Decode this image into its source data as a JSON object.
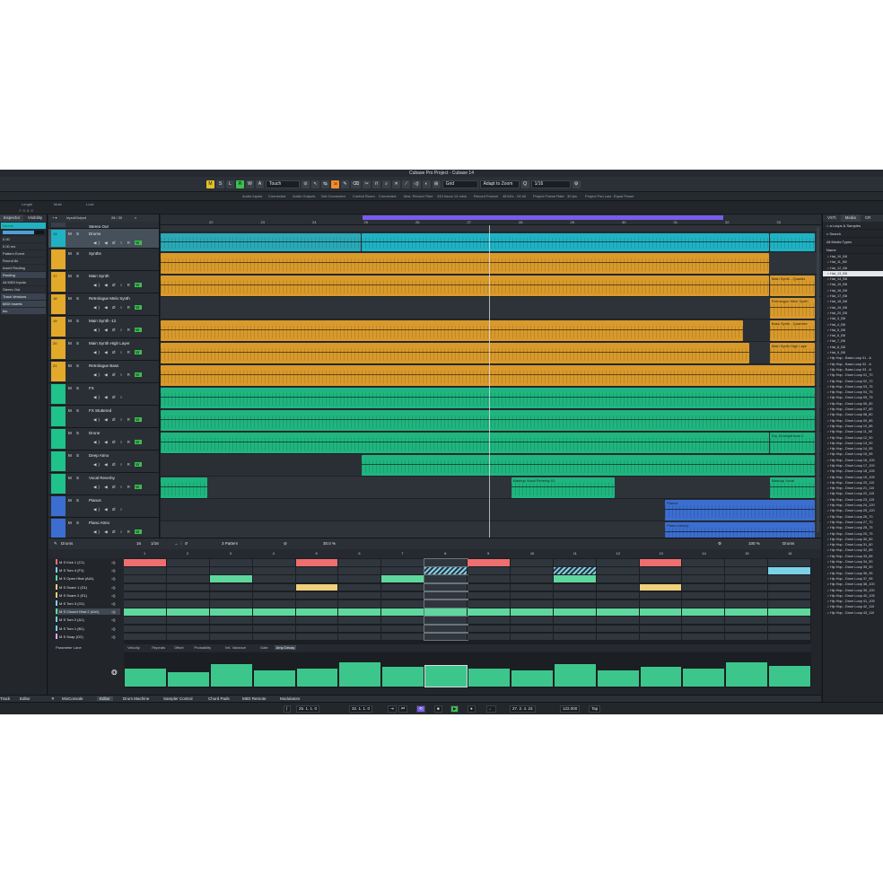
{
  "window_title": "Cubase Pro Project - Cubase 14",
  "colors": {
    "cyan": "#1fb2c3",
    "orange": "#d99a2b",
    "green": "#1fb57f",
    "blue": "#3b6ed0",
    "purple": "#7a5ce8",
    "record_green": "#3cbf4f"
  },
  "toolbar": {
    "state_buttons": [
      "M",
      "S",
      "L",
      "R",
      "W",
      "A"
    ],
    "automation_mode": "Touch",
    "snap_type": "Grid",
    "snap_mode": "Adapt to Zoom",
    "quantize": "1/16"
  },
  "info_bar": [
    {
      "label": "Audio Inputs",
      "value": "Connected"
    },
    {
      "label": "Audio Outputs",
      "value": "Not Connected"
    },
    {
      "label": "Control Room",
      "value": "Connected"
    },
    {
      "label": "Max. Record Time",
      "value": "243 hours 14 mins"
    },
    {
      "label": "Record Format",
      "value": "48 kHz - 24 bit"
    },
    {
      "label": "Project Frame Rate",
      "value": "30 fps"
    },
    {
      "label": "Project Pan Law",
      "value": "Equal Power"
    }
  ],
  "status_line": {
    "length_label": "Length",
    "length_value": "7. 0. 0. 0",
    "mute_label": "Mute",
    "lock_label": "Lock"
  },
  "inspector": {
    "tabs": [
      "Inspector",
      "Visibility"
    ],
    "rows": [
      "Pattern Event",
      "Round 8s",
      "Insert Routing",
      "All MIDI Inputs",
      "Stereo Out"
    ],
    "sections": [
      "Routing",
      "Track Versions",
      "MIDI Inserts",
      "Inc"
    ],
    "volume_label": "0.00",
    "pan_label": "0.00 ms",
    "volume_level": 0.75
  },
  "tracklist": {
    "header": "Input/Output",
    "counter": "28 / 30"
  },
  "tracks": [
    {
      "num": "",
      "name": "Stereo Out",
      "ctl": "",
      "color": "#3a4048",
      "h": 8
    },
    {
      "num": "13",
      "name": "Drums",
      "ctl": "◀) ◀ Ø ○ R W",
      "color": "#1fb2c3",
      "h": 22,
      "sel": true
    },
    {
      "num": "",
      "name": "Synths",
      "ctl": "",
      "color": "#e2a92a",
      "h": 25
    },
    {
      "num": "17",
      "name": "Main Synth",
      "ctl": "◀) ◀ Ø ○ R W",
      "color": "#e2a92a",
      "h": 25
    },
    {
      "num": "18",
      "name": "Retrologue Melo Synth",
      "ctl": "◀) ◀ Ø ○ R W",
      "color": "#e2a92a",
      "h": 25
    },
    {
      "num": "19",
      "name": "Main Synth -12",
      "ctl": "◀) ◀ Ø ○ R W",
      "color": "#e2a92a",
      "h": 25
    },
    {
      "num": "20",
      "name": "Main Synth High Layer",
      "ctl": "◀) ◀ Ø ○ R W",
      "color": "#e2a92a",
      "h": 25
    },
    {
      "num": "21",
      "name": "Retrologue Bass",
      "ctl": "◀) ◀ Ø ○ R W",
      "color": "#e2a92a",
      "h": 25
    },
    {
      "num": "",
      "name": "FX",
      "ctl": "◀) ◀ Ø ○",
      "color": "#1fc28a",
      "h": 25
    },
    {
      "num": "",
      "name": "FX Stuttered",
      "ctl": "◀) ◀ Ø ○ R W",
      "color": "#1fc28a",
      "h": 25
    },
    {
      "num": "",
      "name": "Drone",
      "ctl": "◀) ◀ Ø ○ R W",
      "color": "#1fc28a",
      "h": 25
    },
    {
      "num": "",
      "name": "Deep Atmo",
      "ctl": "◀) ◀ Ø ○ R W",
      "color": "#1fc28a",
      "h": 25
    },
    {
      "num": "",
      "name": "Vocal Reverby",
      "ctl": "◀) ◀ Ø ○ R W",
      "color": "#1fc28a",
      "h": 25
    },
    {
      "num": "",
      "name": "Pianos",
      "ctl": "◀) ◀ Ø ○",
      "color": "#3b6ed0",
      "h": 25
    },
    {
      "num": "",
      "name": "Piano Atmo",
      "ctl": "◀) ◀ Ø ○ R W",
      "color": "#3b6ed0",
      "h": 25
    }
  ],
  "ruler": {
    "labels": [
      "22",
      "23",
      "24",
      "25",
      "26",
      "27",
      "28",
      "29",
      "30",
      "31",
      "32",
      "33"
    ]
  },
  "events": [
    {
      "lane": 1,
      "x0": 0.0,
      "x1": 0.307,
      "color": "#2aa9b6",
      "label": ""
    },
    {
      "lane": 1,
      "x0": 0.307,
      "x1": 0.93,
      "color": "#1fb2c3",
      "label": ""
    },
    {
      "lane": 1,
      "x0": 0.93,
      "x1": 1.0,
      "color": "#1fb2c3",
      "label": ""
    },
    {
      "lane": 2,
      "x0": 0.0,
      "x1": 0.93,
      "color": "#d99a2b",
      "label": ""
    },
    {
      "lane": 3,
      "x0": 0.0,
      "x1": 0.93,
      "color": "#d99a2b",
      "label": ""
    },
    {
      "lane": 3,
      "x0": 0.93,
      "x1": 1.0,
      "color": "#d99a2b",
      "label": "Main Synth - Quantiz"
    },
    {
      "lane": 4,
      "x0": 0.93,
      "x1": 1.0,
      "color": "#d99a2b",
      "label": "Retrologue Melo Synth"
    },
    {
      "lane": 5,
      "x0": 0.0,
      "x1": 0.89,
      "color": "#d99a2b",
      "label": ""
    },
    {
      "lane": 5,
      "x0": 0.93,
      "x1": 1.0,
      "color": "#d99a2b",
      "label": "Bass Synth - Quantize"
    },
    {
      "lane": 6,
      "x0": 0.0,
      "x1": 0.9,
      "color": "#d99a2b",
      "label": ""
    },
    {
      "lane": 6,
      "x0": 0.93,
      "x1": 1.0,
      "color": "#d99a2b",
      "label": "Main Synth High Laye"
    },
    {
      "lane": 7,
      "x0": 0.0,
      "x1": 1.0,
      "color": "#d99a2b",
      "label": ""
    },
    {
      "lane": 8,
      "x0": 0.0,
      "x1": 1.0,
      "color": "#1fb57f",
      "label": ""
    },
    {
      "lane": 9,
      "x0": 0.0,
      "x1": 1.0,
      "color": "#1fb57f",
      "label": ""
    },
    {
      "lane": 10,
      "x0": 0.0,
      "x1": 0.93,
      "color": "#1fb57f",
      "label": ""
    },
    {
      "lane": 10,
      "x0": 0.93,
      "x1": 1.0,
      "color": "#1fb57f",
      "label": "Dry 16-bright tone 2"
    },
    {
      "lane": 11,
      "x0": 0.307,
      "x1": 1.0,
      "color": "#1fb57f",
      "label": ""
    },
    {
      "lane": 12,
      "x0": 0.0,
      "x1": 0.073,
      "color": "#1fb57f",
      "label": ""
    },
    {
      "lane": 12,
      "x0": 0.535,
      "x1": 0.695,
      "color": "#1fb57f",
      "label": "Mashup Vocal Reverby 01"
    },
    {
      "lane": 12,
      "x0": 0.93,
      "x1": 1.0,
      "color": "#1fb57f",
      "label": "Mashup Vocal"
    },
    {
      "lane": 13,
      "x0": 0.77,
      "x1": 1.0,
      "color": "#3b6ed0",
      "label": "Pianos"
    },
    {
      "lane": 14,
      "x0": 0.77,
      "x1": 1.0,
      "color": "#3b6ed0",
      "label": "Piano melody"
    }
  ],
  "editor": {
    "track_name": "Drums",
    "pattern_length": "16",
    "resolution": "1/16",
    "pattern_name": "3 Pattern",
    "swing_value": "30.0 %",
    "zoom_value": "100 %",
    "kit_name": "Drums",
    "step_numbers": [
      "1",
      "2",
      "3",
      "4",
      "5",
      "6",
      "7",
      "8",
      "9",
      "10",
      "11",
      "12",
      "13",
      "14",
      "15",
      "16"
    ],
    "pads": [
      {
        "name": "Kick 1 (C1)",
        "color": "#f06e6e",
        "steps": [
          1,
          0,
          0,
          0,
          1,
          0,
          0,
          0,
          1,
          0,
          0,
          0,
          1,
          0,
          0,
          0
        ]
      },
      {
        "name": "Tom 4 (F1)",
        "color": "#7ad2e8",
        "steps": [
          0,
          0,
          0,
          0,
          0,
          0,
          0,
          2,
          0,
          0,
          2,
          0,
          0,
          0,
          0,
          1
        ]
      },
      {
        "name": "Open Hhat (A#1)",
        "color": "#5fd89e",
        "steps": [
          0,
          0,
          1,
          0,
          0,
          0,
          1,
          0,
          0,
          0,
          1,
          0,
          0,
          0,
          0,
          0
        ]
      },
      {
        "name": "Snare 1 (D1)",
        "color": "#f0d07a",
        "steps": [
          0,
          0,
          0,
          0,
          1,
          0,
          0,
          0,
          0,
          0,
          0,
          0,
          1,
          0,
          0,
          0
        ]
      },
      {
        "name": "Snare 2 (E1)",
        "color": "#f0d07a",
        "steps": [
          0,
          0,
          0,
          0,
          0,
          0,
          0,
          0,
          0,
          0,
          0,
          0,
          0,
          0,
          0,
          0
        ]
      },
      {
        "name": "Tom 3 (G1)",
        "color": "#7ad2e8",
        "steps": [
          0,
          0,
          0,
          0,
          0,
          0,
          0,
          0,
          0,
          0,
          0,
          0,
          0,
          0,
          0,
          0
        ]
      },
      {
        "name": "Closed Hhat 2 (A#1)",
        "color": "#5fd89e",
        "steps": [
          1,
          1,
          1,
          1,
          1,
          1,
          1,
          1,
          1,
          1,
          1,
          1,
          1,
          1,
          1,
          1
        ],
        "selected": true
      },
      {
        "name": "Tom 2 (A1)",
        "color": "#7ad2e8",
        "steps": [
          0,
          0,
          0,
          0,
          0,
          0,
          0,
          0,
          0,
          0,
          0,
          0,
          0,
          0,
          0,
          0
        ]
      },
      {
        "name": "Tom 1 (B1)",
        "color": "#7ad2e8",
        "steps": [
          0,
          0,
          0,
          0,
          0,
          0,
          0,
          0,
          0,
          0,
          0,
          0,
          0,
          0,
          0,
          0
        ]
      },
      {
        "name": "Snap (G2)",
        "color": "#e8a9f0",
        "steps": [
          0,
          0,
          0,
          0,
          0,
          0,
          0,
          0,
          0,
          0,
          0,
          0,
          0,
          0,
          0,
          0
        ]
      }
    ],
    "parameter_lane_label": "Parameter Lane",
    "parameter_tabs": [
      "Velocity",
      "Repeats",
      "Offset",
      "Probability",
      "Vel. Variance",
      "Gate",
      "Amp Decay"
    ],
    "active_tab": "Amp Decay",
    "velocities": [
      0.55,
      0.45,
      0.7,
      0.5,
      0.55,
      0.75,
      0.6,
      0.65,
      0.55,
      0.5,
      0.7,
      0.5,
      0.6,
      0.55,
      0.75,
      0.65
    ]
  },
  "lower_zone_tabs": [
    "Track",
    "Editor",
    "MixConsole",
    "Editor",
    "Drum Machine",
    "Sampler Control",
    "Chord Pads",
    "MIDI Remote",
    "Modulators"
  ],
  "transport": {
    "left_locator": "25. 1. 1. 0",
    "right_locator": "32. 1. 1. 0",
    "position": "27. 2. 4. 23",
    "tempo": "122.000",
    "tap_label": "Tap"
  },
  "right_zone": {
    "tabs": [
      "VSTi",
      "Media",
      "CR"
    ],
    "breadcrumb": "Loops & Samples",
    "search_placeholder": "Search",
    "filter_label": "All Media Types",
    "column_header": "Name",
    "files": [
      "Hat_10_B8",
      "Hat_11_B8",
      "Hat_12_B8",
      "Hat_13_B8",
      "Hat_14_B8",
      "Hat_15_B8",
      "Hat_16_B8",
      "Hat_17_B8",
      "Hat_18_B8",
      "Hat_19_B8",
      "Hat_20_B8",
      "Hat_3_B8",
      "Hat_4_B8",
      "Hat_5_B8",
      "Hat_6_B8",
      "Hat_7_B8",
      "Hat_8_B8",
      "Hat_9_B8",
      "Hip Hop - Bass Loop 01 - A",
      "Hip Hop - Bass Loop 02 - A",
      "Hip Hop - Bass Loop 03 - A",
      "Hip Hop - Drum Loop 01_70",
      "Hip Hop - Drum Loop 02_70",
      "Hip Hop - Drum Loop 03_75",
      "Hip Hop - Drum Loop 04_75",
      "Hip Hop - Drum Loop 05_75",
      "Hip Hop - Drum Loop 06_80",
      "Hip Hop - Drum Loop 07_80",
      "Hip Hop - Drum Loop 08_80",
      "Hip Hop - Drum Loop 09_85",
      "Hip Hop - Drum Loop 10_85",
      "Hip Hop - Drum Loop 11_90",
      "Hip Hop - Drum Loop 12_90",
      "Hip Hop - Drum Loop 13_90",
      "Hip Hop - Drum Loop 14_95",
      "Hip Hop - Drum Loop 15_95",
      "Hip Hop - Drum Loop 16_100",
      "Hip Hop - Drum Loop 17_100",
      "Hip Hop - Drum Loop 18_105",
      "Hip Hop - Drum Loop 19_105",
      "Hip Hop - Drum Loop 20_110",
      "Hip Hop - Drum Loop 21_110",
      "Hip Hop - Drum Loop 22_115",
      "Hip Hop - Drum Loop 23_115",
      "Hip Hop - Drum Loop 24_120",
      "Hip Hop - Drum Loop 25_120",
      "Hip Hop - Drum Loop 26_70",
      "Hip Hop - Drum Loop 27_70",
      "Hip Hop - Drum Loop 28_75",
      "Hip Hop - Drum Loop 29_75",
      "Hip Hop - Drum Loop 30_80",
      "Hip Hop - Drum Loop 31_80",
      "Hip Hop - Drum Loop 32_85",
      "Hip Hop - Drum Loop 33_85",
      "Hip Hop - Drum Loop 34_90",
      "Hip Hop - Drum Loop 35_90",
      "Hip Hop - Drum Loop 36_95",
      "Hip Hop - Drum Loop 37_95",
      "Hip Hop - Drum Loop 38_100",
      "Hip Hop - Drum Loop 39_100",
      "Hip Hop - Drum Loop 40_105",
      "Hip Hop - Drum Loop 41_105",
      "Hip Hop - Drum Loop 42_110",
      "Hip Hop - Drum Loop 43_110"
    ],
    "selected_index": 3,
    "preview_time": "0:00"
  }
}
